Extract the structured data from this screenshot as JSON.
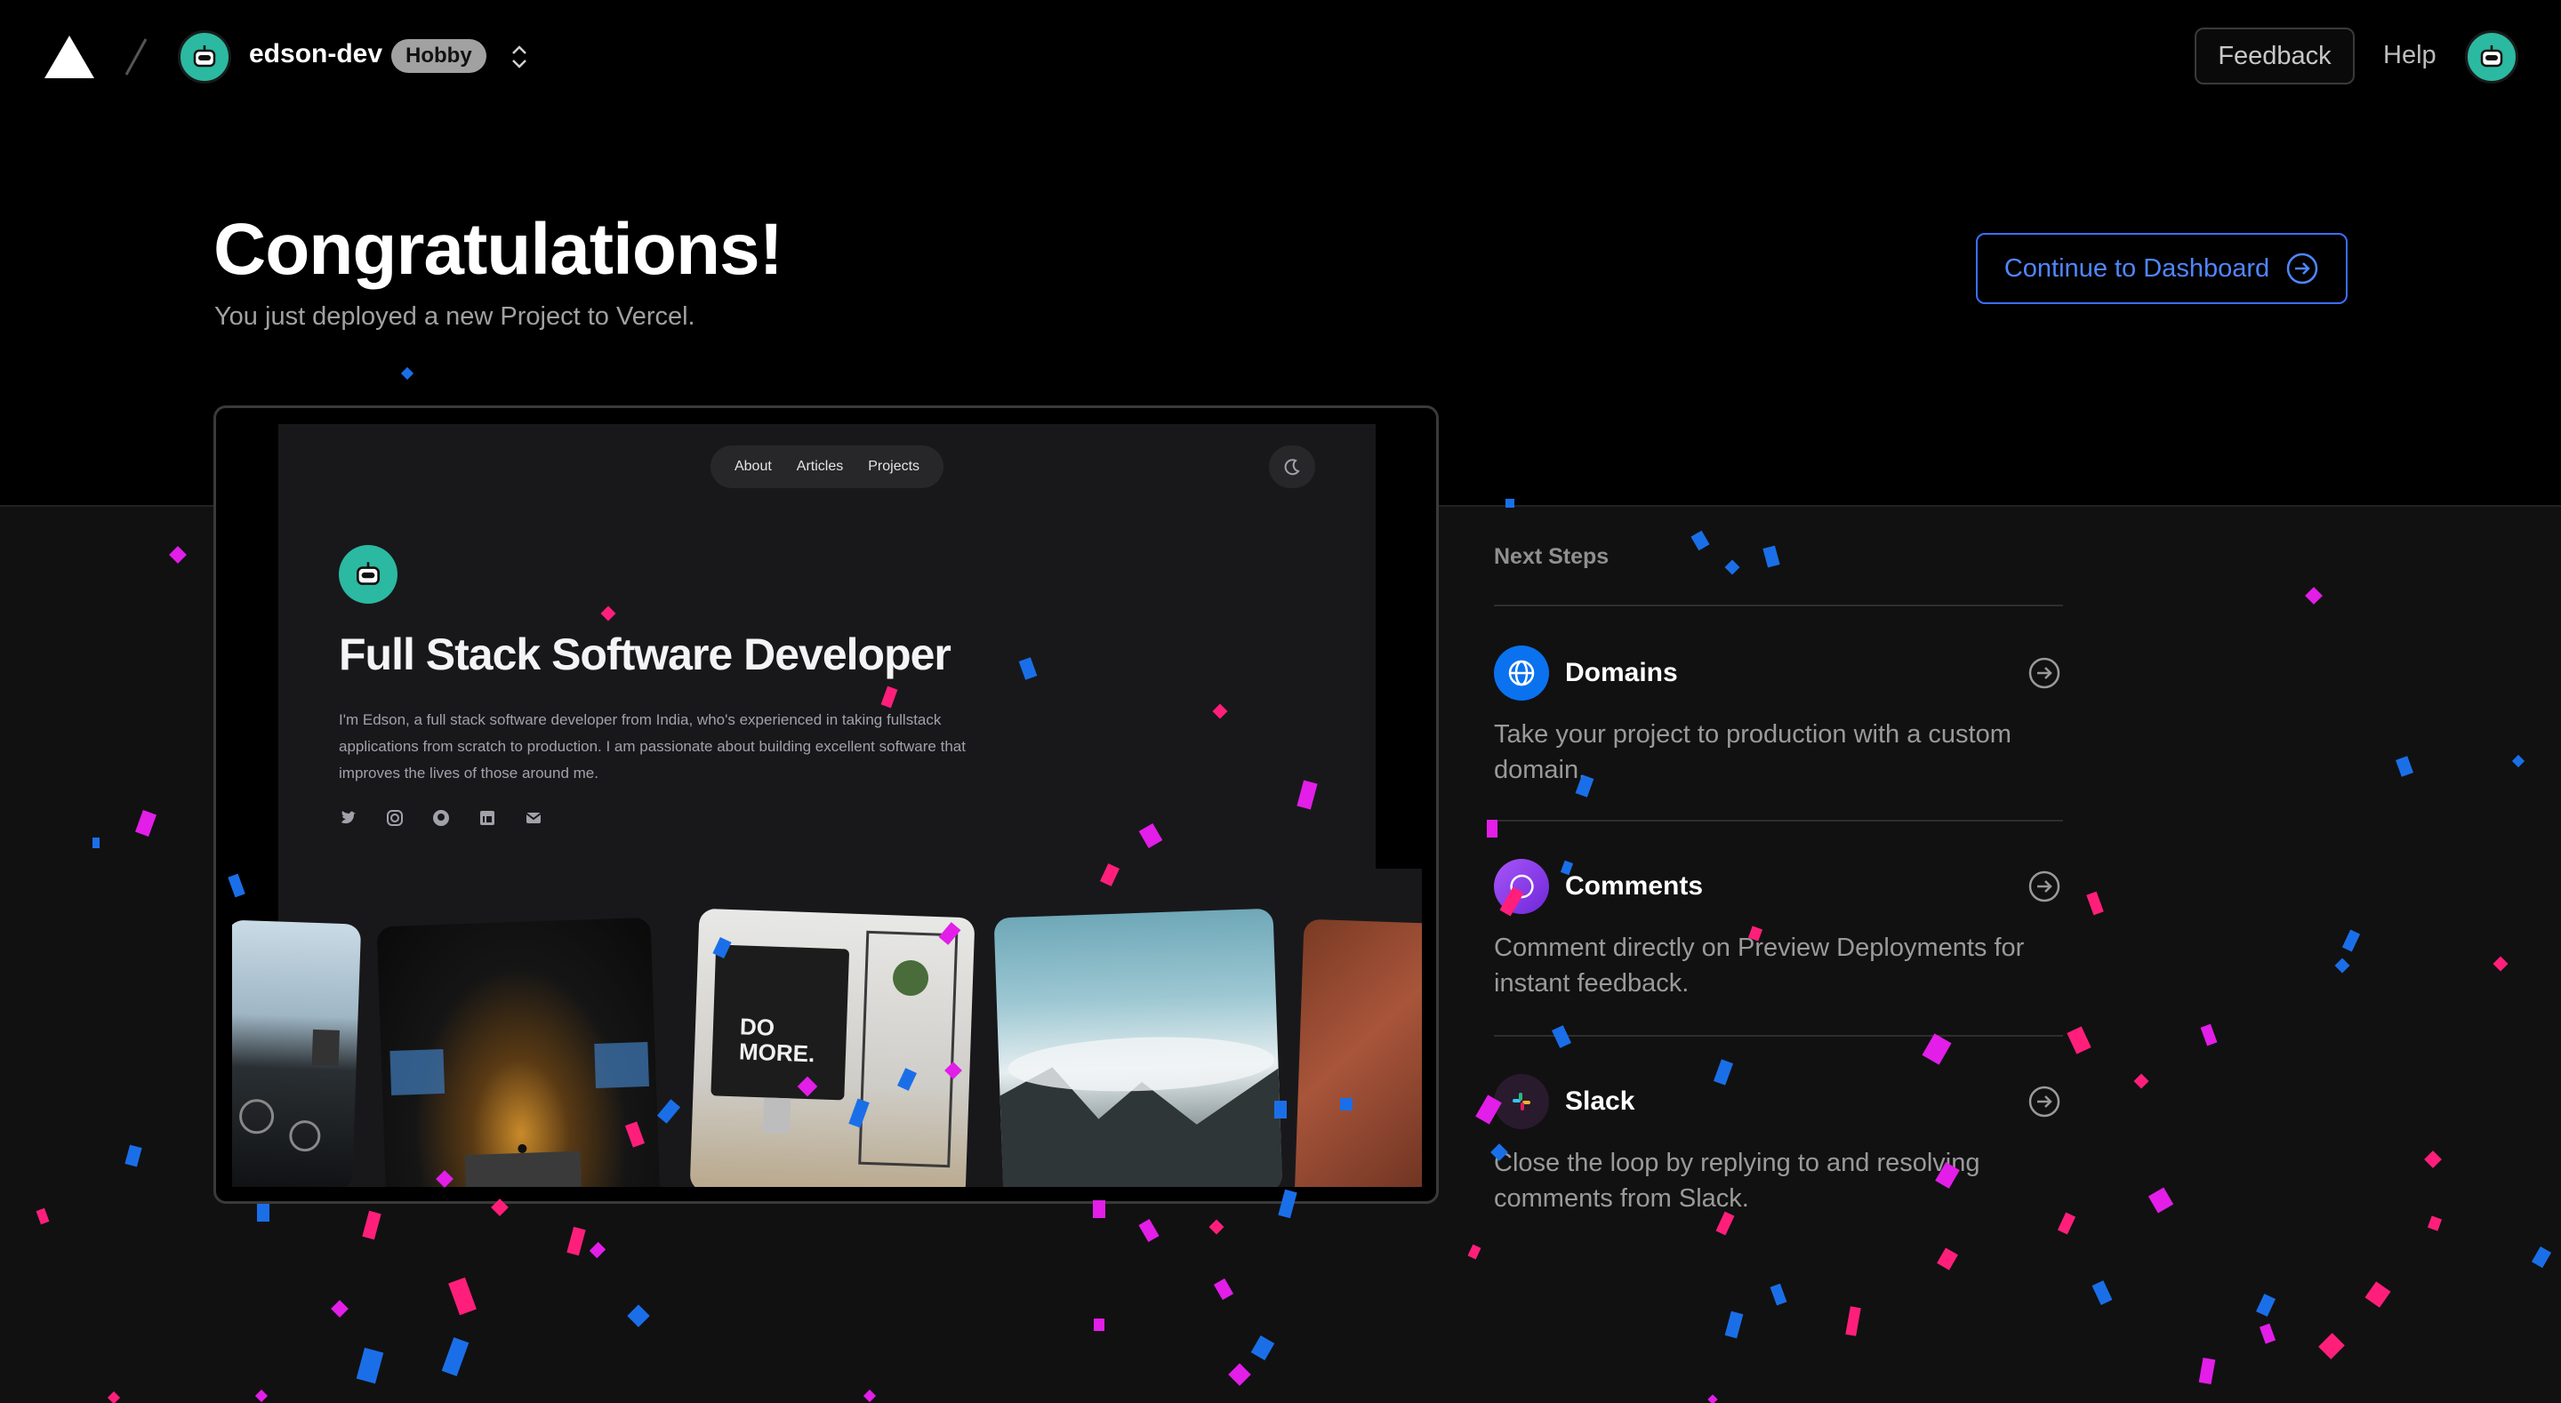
{
  "header": {
    "team_name": "edson-dev",
    "plan": "Hobby",
    "feedback_label": "Feedback",
    "help_label": "Help"
  },
  "hero": {
    "title": "Congratulations!",
    "subtitle": "You just deployed a new Project to Vercel.",
    "continue_label": "Continue to Dashboard"
  },
  "preview": {
    "nav": [
      "About",
      "Articles",
      "Projects"
    ],
    "title": "Full Stack Software Developer",
    "description": "I'm Edson, a full stack software developer from India, who's experienced in taking fullstack applications from scratch to production. I am passionate about building excellent software that improves the lives of those around me.",
    "socials": [
      "twitter-icon",
      "instagram-icon",
      "github-icon",
      "linkedin-icon",
      "mail-icon"
    ],
    "photo_text": "DO MORE."
  },
  "next_steps": {
    "title": "Next Steps",
    "items": [
      {
        "name": "Domains",
        "description": "Take your project to production with a custom domain.",
        "icon": "globe-icon",
        "color": "#0a72ef"
      },
      {
        "name": "Comments",
        "description": "Comment directly on Preview Deployments for instant feedback.",
        "icon": "comment-icon",
        "color": "#7c3aed"
      },
      {
        "name": "Slack",
        "description": "Close the loop by replying to and resolving comments from Slack.",
        "icon": "slack-icon",
        "color": "#2a1a2e"
      }
    ]
  },
  "colors": {
    "accent": "#3b6fff",
    "avatar": "#2bb9a1",
    "confetti_blue": "#1a6fe8",
    "confetti_pink": "#ff1f7a",
    "confetti_magenta": "#e21ee8"
  }
}
